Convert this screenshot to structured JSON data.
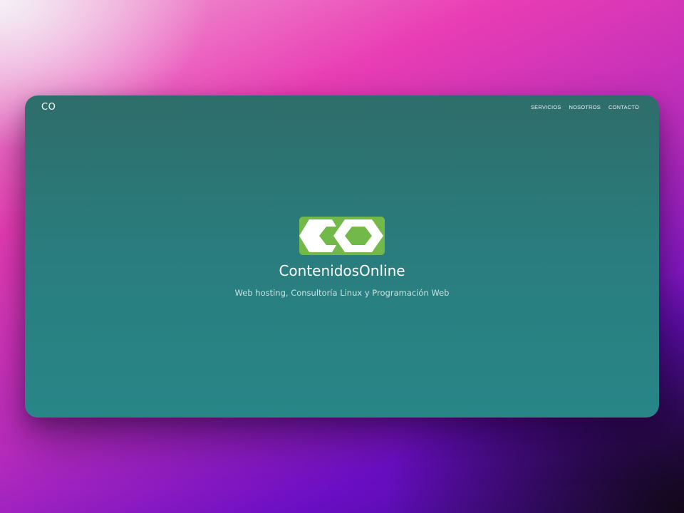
{
  "nav": {
    "brand": "CO",
    "items": [
      {
        "label": "SERVICIOS"
      },
      {
        "label": "NOSOTROS"
      },
      {
        "label": "CONTACTO"
      }
    ]
  },
  "hero": {
    "logo_icon": "co-hexagon-logo-icon",
    "title": "ContenidosOnline",
    "tagline": "Web hosting, Consultoría Linux y Programación Web"
  },
  "colors": {
    "logo_green": "#72b94a",
    "panel_top": "#2e6d6a",
    "panel_bottom": "#288687"
  }
}
